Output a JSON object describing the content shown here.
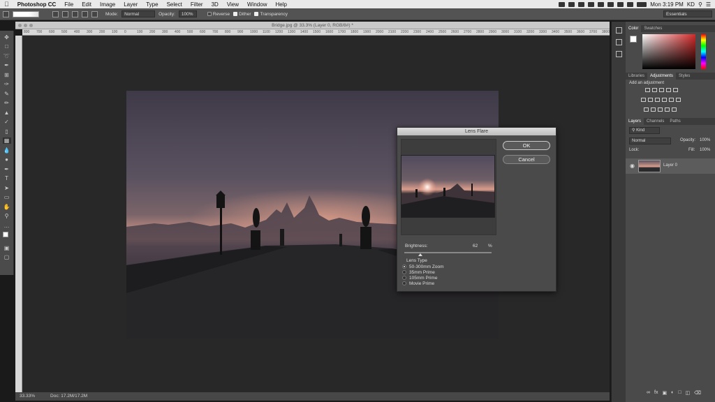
{
  "menubar": {
    "apple": "",
    "app_name": "Photoshop CC",
    "menus": [
      "File",
      "Edit",
      "Image",
      "Layer",
      "Type",
      "Select",
      "Filter",
      "3D",
      "View",
      "Window",
      "Help"
    ],
    "clock": "Mon 3:19 PM",
    "user": "KD"
  },
  "options_bar": {
    "mode_label": "Mode:",
    "mode_value": "Normal",
    "opacity_label": "Opacity:",
    "opacity_value": "100%",
    "reverse_label": "Reverse",
    "dither_label": "Dither",
    "transparency_label": "Transparency",
    "workspace": "Essentials"
  },
  "document": {
    "tab_title": "Bridge.jpg @ 33.3% (Layer 0, RGB/8#) *",
    "ruler_ticks": [
      "800",
      "700",
      "600",
      "500",
      "400",
      "300",
      "200",
      "100",
      "0",
      "100",
      "200",
      "300",
      "400",
      "500",
      "600",
      "700",
      "800",
      "900",
      "1000",
      "1100",
      "1200",
      "1300",
      "1400",
      "1500",
      "1600",
      "1700",
      "1800",
      "1900",
      "2000",
      "2100",
      "2200",
      "2300",
      "2400",
      "2500",
      "2600",
      "2700",
      "2800",
      "2900",
      "3000",
      "3100",
      "3200",
      "3300",
      "3400",
      "3500",
      "3600",
      "3700",
      "3800"
    ],
    "zoom": "33.33%",
    "doc_size": "Doc: 17.2M/17.2M"
  },
  "dialog": {
    "title": "Lens Flare",
    "ok_label": "OK",
    "cancel_label": "Cancel",
    "brightness_label": "Brightness:",
    "brightness_value": "62",
    "brightness_unit": "%",
    "lens_type_label": "Lens Type",
    "lens_types": [
      "50-300mm Zoom",
      "35mm Prime",
      "105mm Prime",
      "Movie Prime"
    ],
    "selected_lens": 0
  },
  "panels": {
    "color_tabs": [
      "Color",
      "Swatches"
    ],
    "adj_tabs": [
      "Libraries",
      "Adjustments",
      "Styles"
    ],
    "add_adjustment": "Add an adjustment",
    "layer_tabs": [
      "Layers",
      "Channels",
      "Paths"
    ],
    "kind_label": "Kind",
    "blend_mode": "Normal",
    "opacity_label": "Opacity:",
    "opacity_value": "100%",
    "lock_label": "Lock:",
    "fill_label": "Fill:",
    "fill_value": "100%",
    "layer_name": "Layer 0"
  },
  "colors": {
    "ui_dark": "#282828",
    "panel": "#4a4a4a",
    "accent_red": "#d42a2a"
  }
}
